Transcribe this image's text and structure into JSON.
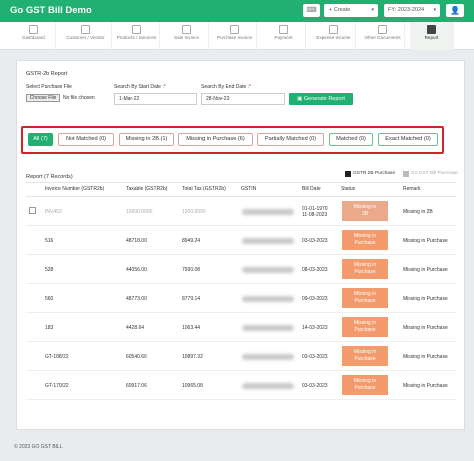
{
  "header": {
    "app_title": "Go GST Bill Demo",
    "kbd_icon": "⌨",
    "create_label": "+ Create",
    "fy_label": "FY: 2023-2024",
    "avatar_icon": "👤",
    "caret": "▾"
  },
  "nav": [
    {
      "label": "Dashboard",
      "icon": "dashboard-icon"
    },
    {
      "label": "Customer / Vendor",
      "icon": "users-icon"
    },
    {
      "label": "Products / Services",
      "icon": "box-icon"
    },
    {
      "label": "Sale Invoice",
      "icon": "invoice-icon"
    },
    {
      "label": "Purchase Invoice",
      "icon": "purchase-icon"
    },
    {
      "label": "Payment",
      "icon": "payment-icon"
    },
    {
      "label": "Expense Income",
      "icon": "expense-icon"
    },
    {
      "label": "Other Documents",
      "icon": "documents-icon"
    },
    {
      "label": "Report",
      "icon": "report-icon"
    }
  ],
  "form": {
    "section_title": "GSTR-2b Report",
    "file_label": "Select Purchase File",
    "file_button": "Choose File",
    "file_status": "No file chosen",
    "start_label": "Search By Start Date :",
    "start_value": "1-Mar-22",
    "end_label": "Search By End Date :",
    "end_value": "28-Nov-23",
    "required_mark": "*",
    "generate_label": "Generate Report"
  },
  "filters": [
    "All (7)",
    "Not Matched (0)",
    "Missing in 2B (1)",
    "Missing in Purchase (6)",
    "Partially Matched (0)",
    "Matched (0)",
    "Exact Matched (0)"
  ],
  "legend": {
    "gstr": "GSTR 2B Purchase",
    "gogst": "Go GST Bill Purchase",
    "gstr_color": "#222222",
    "gogst_color": "#bbbbbb"
  },
  "report": {
    "title": "Report (7 Records)",
    "columns": [
      "Invoice Number (GSTR2b)",
      "Taxable (GSTR2b)",
      "Total Tax (GSTR2b)",
      "GSTIN",
      "Bill Date",
      "Status",
      "Remark"
    ],
    "rows": [
      {
        "invoice": "INV453",
        "taxable": "10000.0000",
        "tax": "1200.0000",
        "date1": "01-01-1970",
        "date2": "11-08-2023",
        "status1": "Missing in",
        "status2": "2B",
        "remark": "Missing in 2B"
      },
      {
        "invoice": "516",
        "taxable": "48718.00",
        "tax": "8949.24",
        "date1": "03-03-2023",
        "date2": "",
        "status1": "Missing in",
        "status2": "Purchase",
        "remark": "Missing in Purchase"
      },
      {
        "invoice": "528",
        "taxable": "44056.00",
        "tax": "7930.08",
        "date1": "08-03-2023",
        "date2": "",
        "status1": "Missing in",
        "status2": "Purchase",
        "remark": "Missing in Purchase"
      },
      {
        "invoice": "560",
        "taxable": "48773.00",
        "tax": "8779.14",
        "date1": "09-03-2023",
        "date2": "",
        "status1": "Missing in",
        "status2": "Purchase",
        "remark": "Missing in Purchase"
      },
      {
        "invoice": "183",
        "taxable": "4428.64",
        "tax": "1063.44",
        "date1": "14-03-2023",
        "date2": "",
        "status1": "Missing in",
        "status2": "Purchase",
        "remark": "Missing in Purchase"
      },
      {
        "invoice": "GT-188/22",
        "taxable": "60540.66",
        "tax": "10897.32",
        "date1": "03-03-2023",
        "date2": "",
        "status1": "Missing in",
        "status2": "Purchase",
        "remark": "Missing in Purchase"
      },
      {
        "invoice": "GT-170/22",
        "taxable": "60917.06",
        "tax": "10965.08",
        "date1": "03-03-2023",
        "date2": "",
        "status1": "Missing in",
        "status2": "Purchase",
        "remark": "Missing in Purchase"
      }
    ]
  },
  "footer": "© 2023 GO GST BILL"
}
